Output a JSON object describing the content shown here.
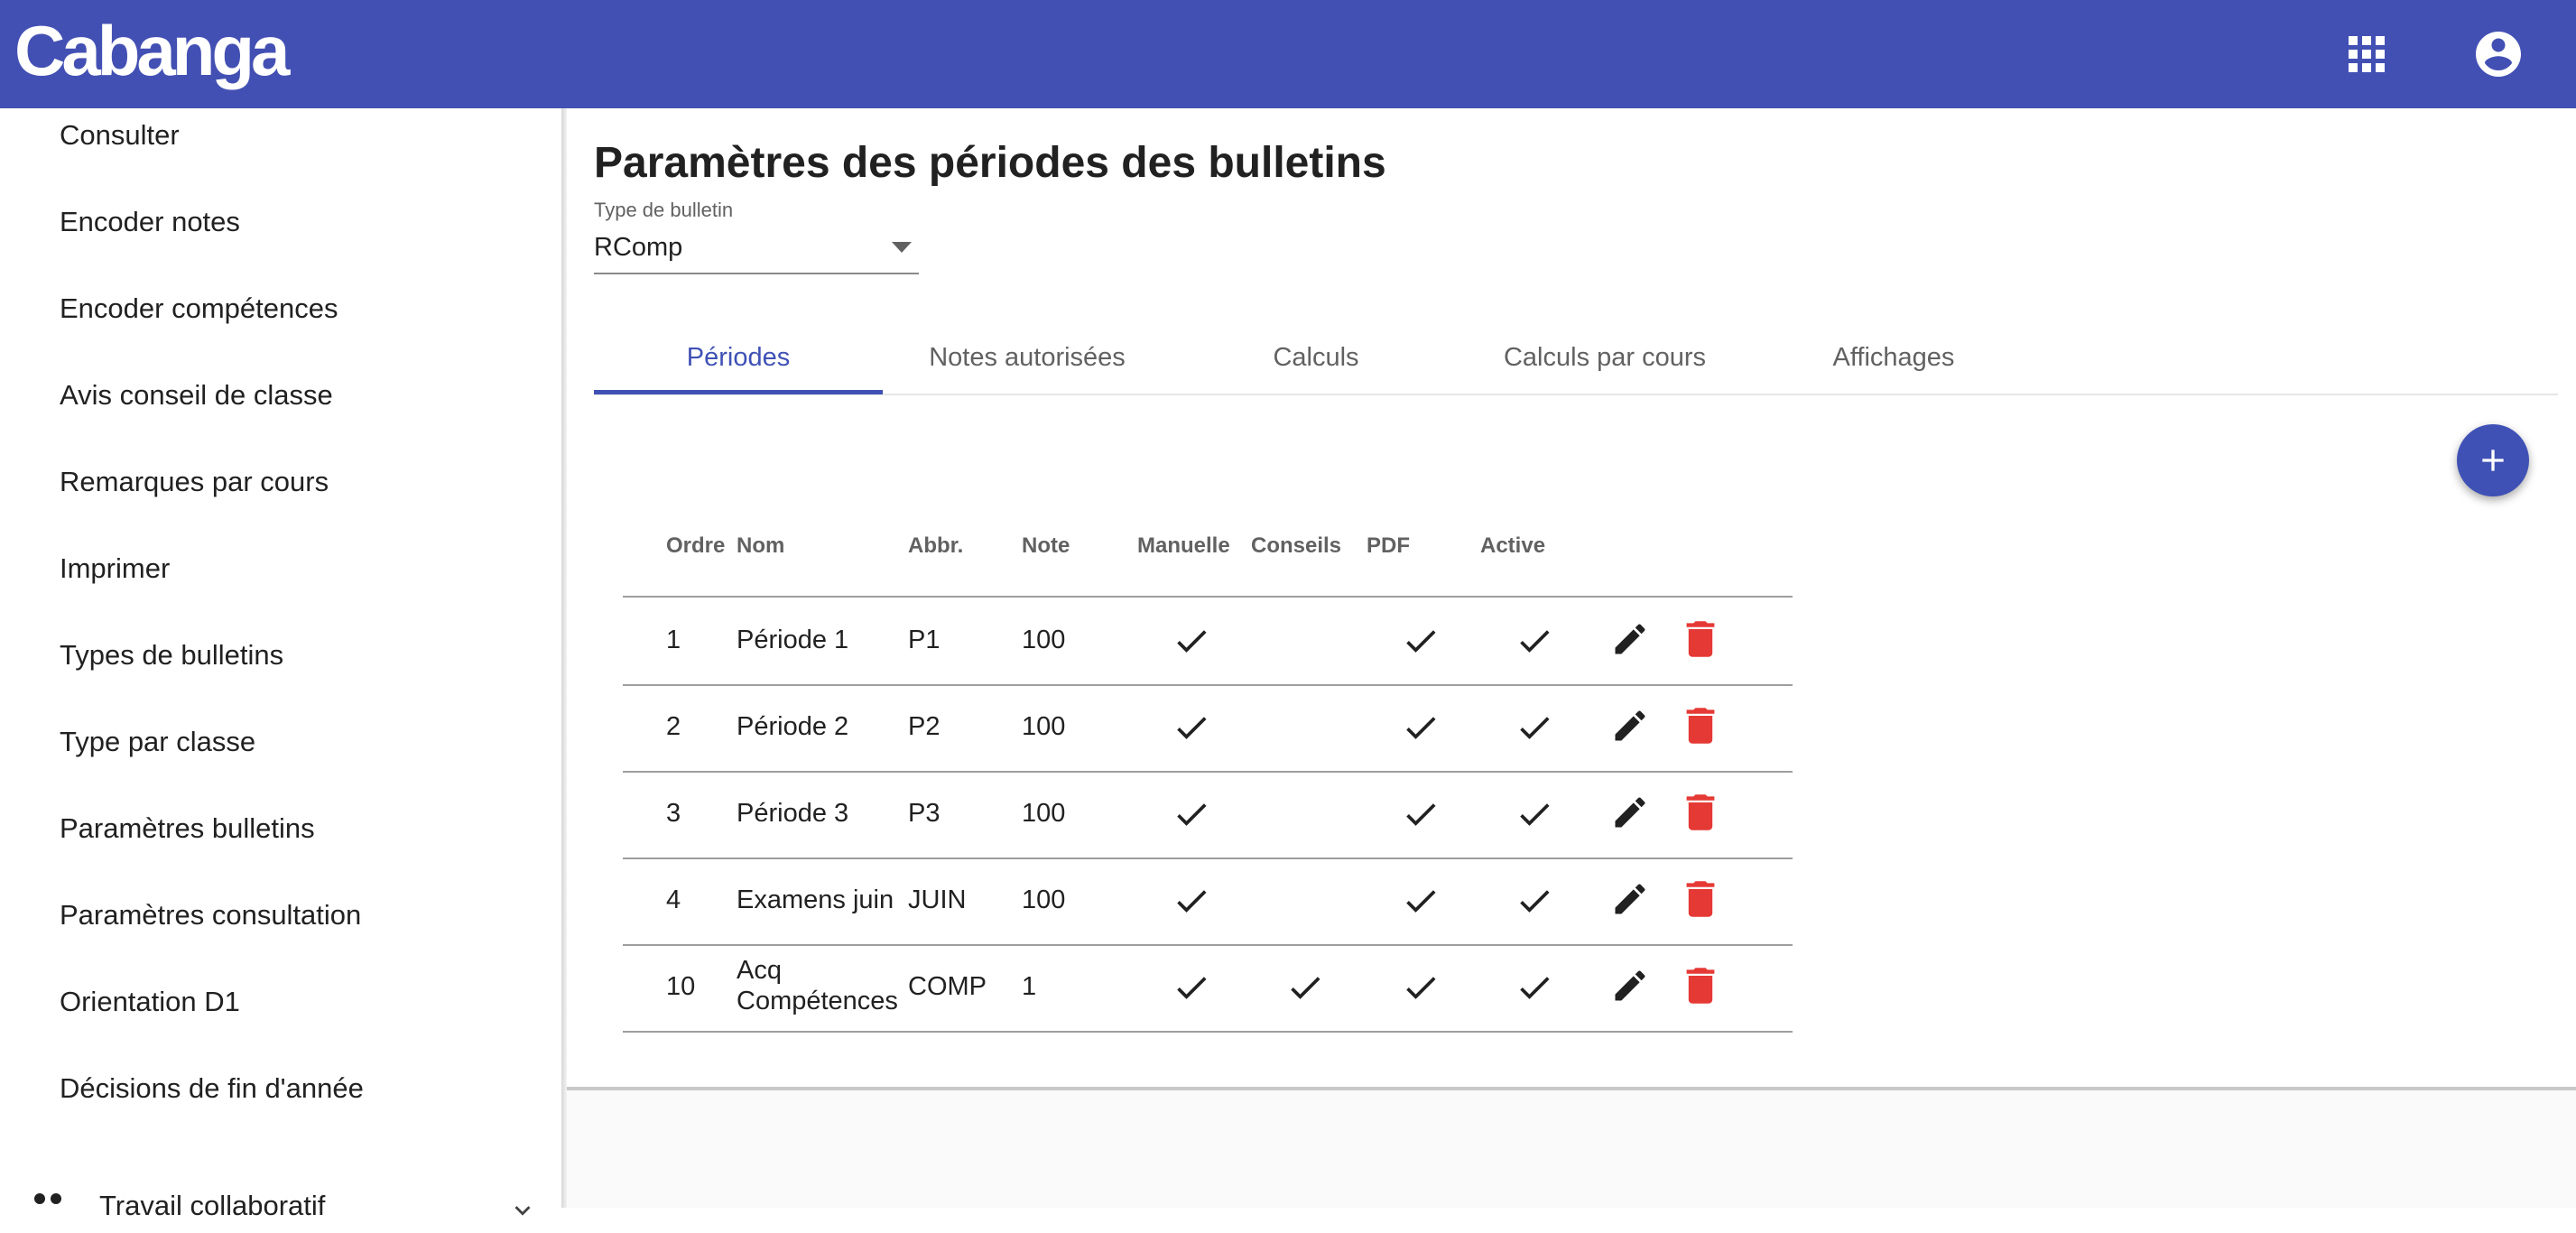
{
  "app": {
    "logo": "Cabanga",
    "apps_icon": "apps-grid-icon",
    "account_icon": "account-circle-icon"
  },
  "sidebar": {
    "items": [
      {
        "label": "Consulter"
      },
      {
        "label": "Encoder notes"
      },
      {
        "label": "Encoder compétences"
      },
      {
        "label": "Avis conseil de classe"
      },
      {
        "label": "Remarques par cours"
      },
      {
        "label": "Imprimer"
      },
      {
        "label": "Types de bulletins"
      },
      {
        "label": "Type par classe"
      },
      {
        "label": "Paramètres bulletins"
      },
      {
        "label": "Paramètres consultation"
      },
      {
        "label": "Orientation D1"
      },
      {
        "label": "Décisions de fin d'année"
      }
    ],
    "group": {
      "label": "Travail collaboratif",
      "icon": "group-icon"
    }
  },
  "page": {
    "title": "Paramètres des périodes des bulletins",
    "select": {
      "label": "Type de bulletin",
      "value": "RComp"
    },
    "tabs": [
      {
        "label": "Périodes",
        "active": true
      },
      {
        "label": "Notes autorisées"
      },
      {
        "label": "Calculs"
      },
      {
        "label": "Calculs par cours"
      },
      {
        "label": "Affichages"
      }
    ],
    "colors": {
      "primary": "#3f51b5",
      "topbar": "#4350b3",
      "delete": "#e53935"
    }
  },
  "table": {
    "headers": {
      "ordre": "Ordre",
      "nom": "Nom",
      "abbr": "Abbr.",
      "note": "Note",
      "manuelle": "Manuelle",
      "conseils": "Conseils",
      "pdf": "PDF",
      "active": "Active"
    },
    "rows": [
      {
        "ordre": "1",
        "nom": "Période 1",
        "nom2": "",
        "abbr": "P1",
        "note": "100",
        "manuelle": true,
        "conseils": false,
        "pdf": true,
        "active": true
      },
      {
        "ordre": "2",
        "nom": "Période 2",
        "nom2": "",
        "abbr": "P2",
        "note": "100",
        "manuelle": true,
        "conseils": false,
        "pdf": true,
        "active": true
      },
      {
        "ordre": "3",
        "nom": "Période 3",
        "nom2": "",
        "abbr": "P3",
        "note": "100",
        "manuelle": true,
        "conseils": false,
        "pdf": true,
        "active": true
      },
      {
        "ordre": "4",
        "nom": "Examens juin",
        "nom2": "",
        "abbr": "JUIN",
        "note": "100",
        "manuelle": true,
        "conseils": false,
        "pdf": true,
        "active": true
      },
      {
        "ordre": "10",
        "nom": "Acq",
        "nom2": "Compétences",
        "abbr": "COMP",
        "note": "1",
        "manuelle": true,
        "conseils": true,
        "pdf": true,
        "active": true
      }
    ]
  }
}
